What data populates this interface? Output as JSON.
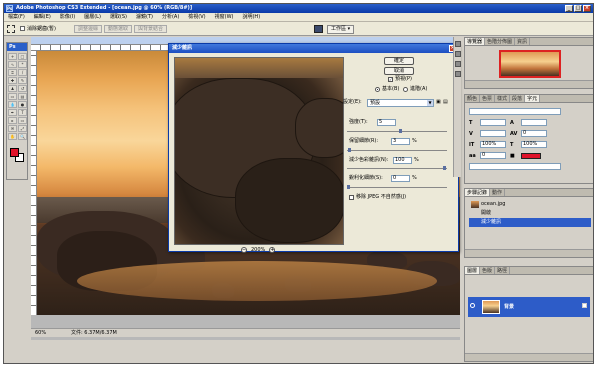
{
  "app": {
    "title": "Adobe Photoshop CS3 Extended - [ocean.jpg @ 60% (RGB/8#)]",
    "icon": "Ps"
  },
  "menu": {
    "items": [
      "檔案(F)",
      "編輯(E)",
      "影像(I)",
      "圖層(L)",
      "選取(S)",
      "濾鏡(T)",
      "分析(A)",
      "檢視(V)",
      "視窗(W)",
      "說明(H)"
    ]
  },
  "options": {
    "checkbox_label": "消除鋸齒(暫)",
    "btn1": "調整邊緣",
    "btn2": "動態選取",
    "btn3": "與背景結合",
    "workspace": "工作區 ▾"
  },
  "toolbox": {
    "title": "Ps",
    "fg_color": "#e0122a",
    "bg_color": "#ffffff"
  },
  "document": {
    "zoom": "60%",
    "doc_info": "文件: 6.37M/6.37M"
  },
  "dialog": {
    "title": "減少雜訊",
    "ok": "確定",
    "cancel": "取消",
    "preview_label": "預視(P)",
    "basic_label": "基本(B)",
    "advanced_label": "進階(A)",
    "settings_label": "設定(E):",
    "settings_value": "預設",
    "strength_label": "強度(T):",
    "strength_value": "5",
    "preserve_label": "保留細節(R):",
    "preserve_value": "3",
    "preserve_unit": "%",
    "color_noise_label": "減少色彩雜訊(N):",
    "color_noise_value": "100",
    "color_noise_unit": "%",
    "sharpen_label": "銳利化細節(S):",
    "sharpen_value": "0",
    "sharpen_unit": "%",
    "jpeg_label": "移除 JPEG 不自然感(J)",
    "zoom_value": "200%",
    "zoom_out": "−",
    "zoom_in": "+"
  },
  "panels": {
    "navigator_tabs": [
      "導覽器",
      "色階分佈圖",
      "資訊"
    ],
    "char_tabs": [
      "顏色",
      "色票",
      "樣式",
      "段落",
      "字元"
    ],
    "char_rows": [
      {
        "icon": "T",
        "value": "",
        "icon2": "A",
        "value2": ""
      },
      {
        "icon": "V",
        "value": "",
        "icon2": "AV",
        "value2": "0"
      },
      {
        "icon": "IT",
        "value": "100%",
        "icon2": "T",
        "value2": "100%"
      },
      {
        "icon": "aa",
        "value": "0",
        "icon2": "",
        "value2": ""
      }
    ],
    "history_tabs": [
      "步驟記錄",
      "動作"
    ],
    "history_items": [
      "ocean.jpg",
      "開啟",
      "減少雜訊"
    ],
    "layers_tabs": [
      "圖層",
      "色版",
      "路徑"
    ],
    "layer_name": "背景"
  }
}
